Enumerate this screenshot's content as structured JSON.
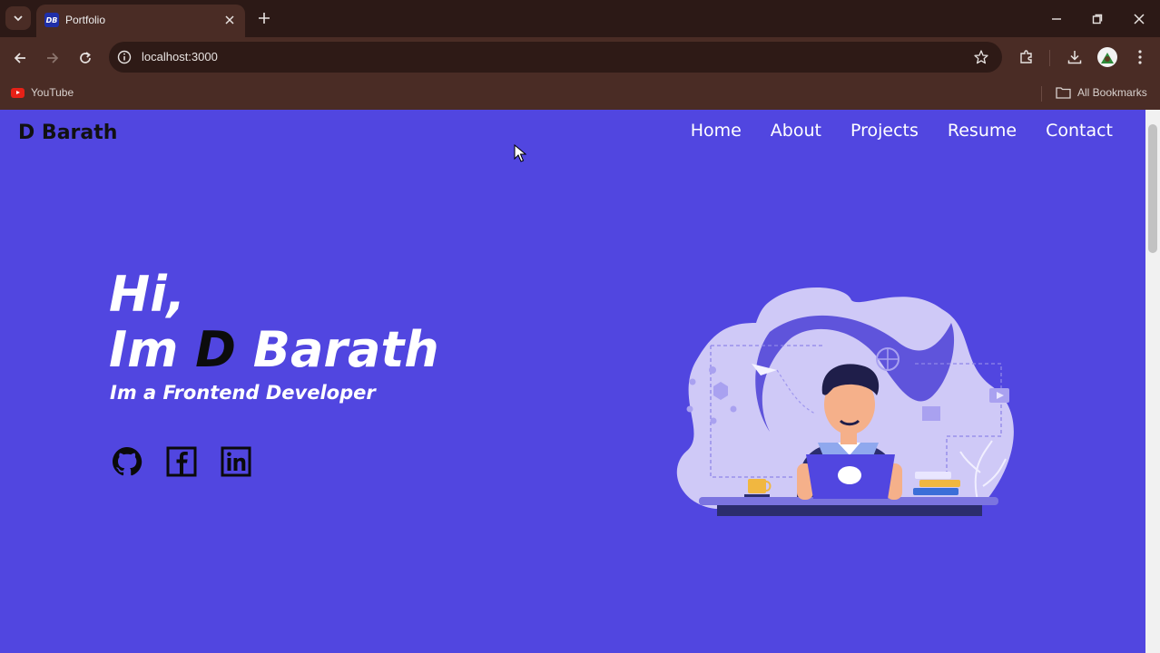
{
  "browser": {
    "tab_title": "Portfolio",
    "favicon_text": "DB",
    "url": "localhost:3000",
    "bookmarks": [
      {
        "label": "YouTube",
        "icon": "youtube-icon"
      }
    ],
    "all_bookmarks_label": "All Bookmarks"
  },
  "site": {
    "logo": "D Barath",
    "nav": [
      "Home",
      "About",
      "Projects",
      "Resume",
      "Contact"
    ]
  },
  "hero": {
    "greeting": "Hi,",
    "name_prefix": "Im ",
    "name_accent": "D",
    "name_rest": " Barath",
    "subtitle": "Im a Frontend Developer",
    "social": [
      "github-icon",
      "facebook-icon",
      "linkedin-icon"
    ]
  },
  "colors": {
    "page_bg": "#5146e0",
    "chrome_dark": "#2c1916",
    "chrome": "#4a2c25",
    "illustration_light": "#cfc9f7",
    "illustration_dark": "#3b2fa8"
  }
}
